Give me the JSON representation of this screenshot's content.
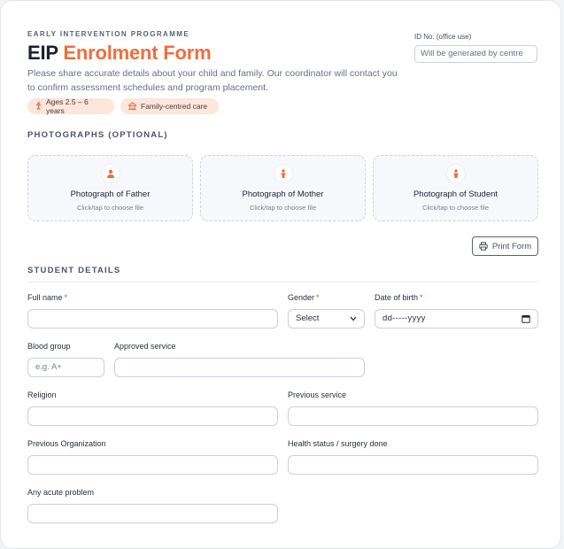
{
  "header": {
    "eyebrow": "EARLY INTERVENTION PROGRAMME",
    "title_main": "EIP",
    "title_accent": "Enrolment Form",
    "description": "Please share accurate details about your child and family. Our coordinator will contact you to confirm assessment schedules and program placement.",
    "pills": [
      {
        "icon": "child-icon",
        "label": "Ages 2.5 – 6 years"
      },
      {
        "icon": "home-icon",
        "label": "Family-centred care"
      }
    ],
    "id_label": "ID No. (office use)",
    "id_placeholder": "Will be generated by centre"
  },
  "photos": {
    "heading": "PHOTOGRAPHS (OPTIONAL)",
    "items": [
      {
        "icon": "person-icon",
        "title": "Photograph of Father",
        "hint": "Click/tap to choose file"
      },
      {
        "icon": "person-icon",
        "title": "Photograph of Mother",
        "hint": "Click/tap to choose file"
      },
      {
        "icon": "person-icon",
        "title": "Photograph of Student",
        "hint": "Click/tap to choose file"
      }
    ]
  },
  "toolbar": {
    "print_label": "Print Form"
  },
  "student": {
    "heading": "STUDENT DETAILS",
    "full_name": {
      "label": "Full name",
      "required": "*",
      "value": ""
    },
    "gender": {
      "label": "Gender",
      "required": "*",
      "selected": "Select"
    },
    "dob": {
      "label": "Date of birth",
      "required": "*",
      "value": "dd-----yyyy"
    },
    "blood_group": {
      "label": "Blood group",
      "placeholder": "e.g. A+"
    },
    "approved_service": {
      "label": "Approved service",
      "value": ""
    },
    "religion": {
      "label": "Religion",
      "value": ""
    },
    "previous_service": {
      "label": "Previous service",
      "value": ""
    },
    "previous_org": {
      "label": "Previous Organization",
      "value": ""
    },
    "health_status": {
      "label": "Health status / surgery done",
      "value": ""
    },
    "acute_problem": {
      "label": "Any acute problem",
      "value": ""
    }
  },
  "colors": {
    "accent": "#ef6e3f",
    "pill_bg": "#fde6dc",
    "required": "#e5533a"
  }
}
